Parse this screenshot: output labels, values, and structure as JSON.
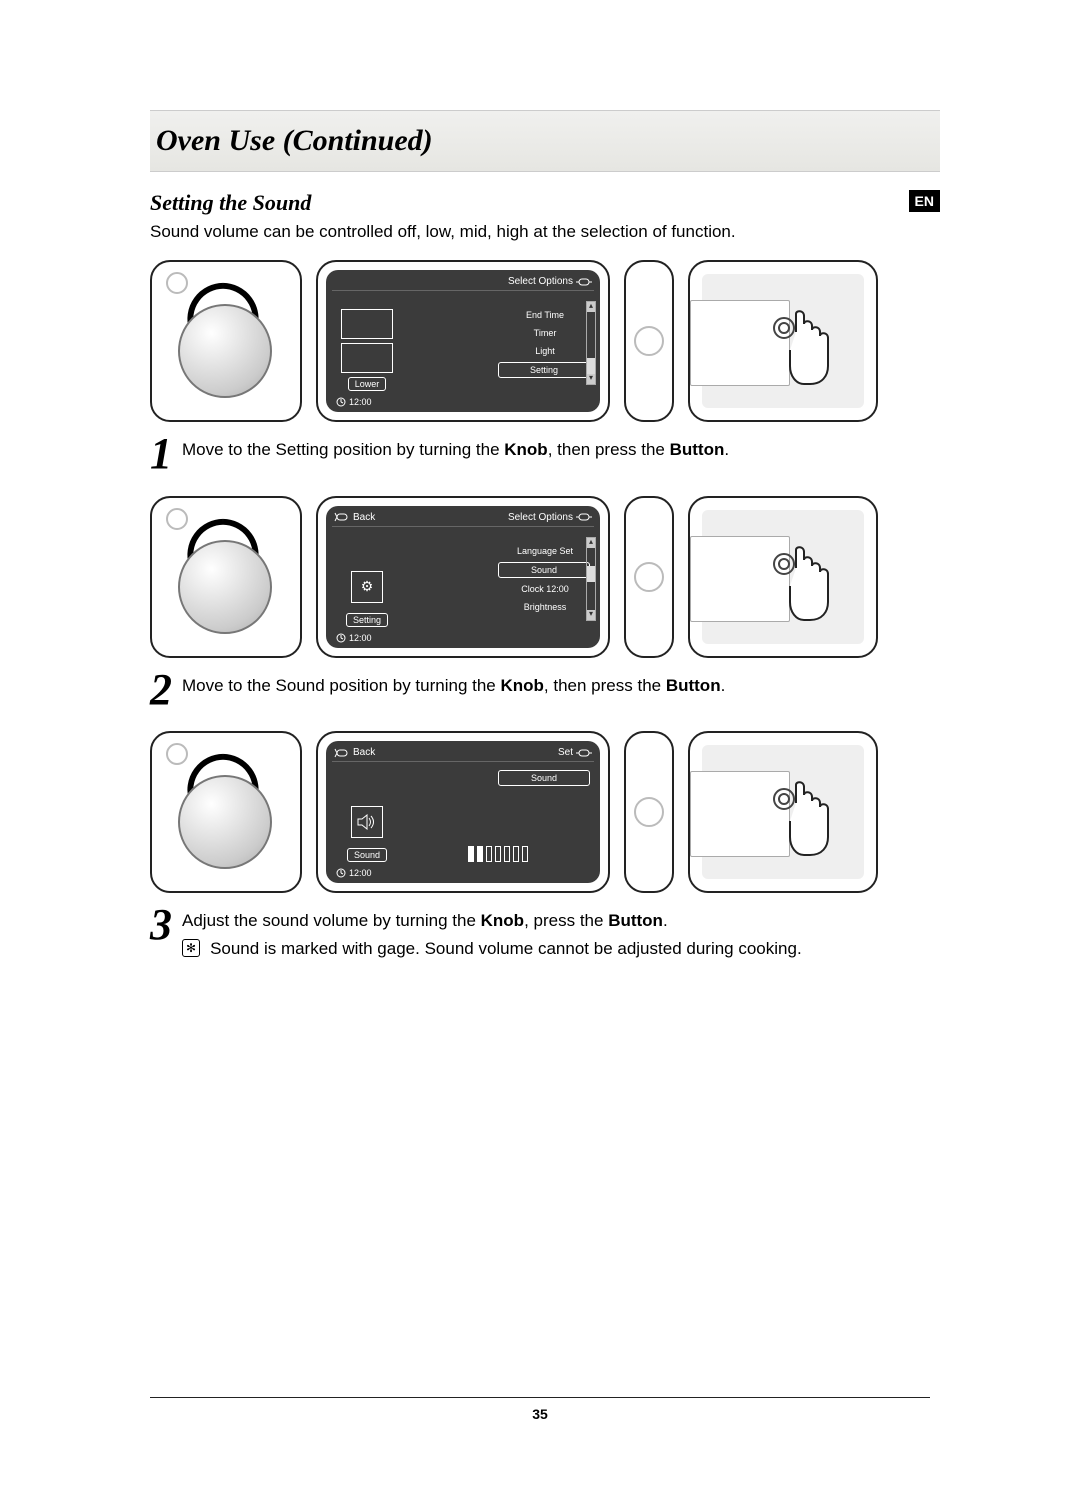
{
  "title": "Oven Use (Continued)",
  "lang_badge": "EN",
  "subhead": "Setting the Sound",
  "intro": "Sound volume can be controlled off, low, mid, high at the selection of function.",
  "page_number": "35",
  "common": {
    "clock": "12:00",
    "back_label": "Back",
    "select_options_label": "Select Options",
    "set_label": "Set"
  },
  "steps": [
    {
      "num": "1",
      "caption_pre": "Move to the Setting position by turning the ",
      "caption_bold1": "Knob",
      "caption_mid": ", then press the ",
      "caption_bold2": "Button",
      "caption_post": ".",
      "lcd": {
        "show_back": false,
        "top_right": "Select Options",
        "left_mode": "thumbs",
        "left_tag": "Lower",
        "menu": [
          "End Time",
          "Timer",
          "Light",
          "Setting"
        ],
        "highlight_index": 3,
        "scroll_pos": "bottom",
        "show_volume": false,
        "right_label": null
      }
    },
    {
      "num": "2",
      "caption_pre": "Move to the Sound position by turning the ",
      "caption_bold1": "Knob",
      "caption_mid": ", then press the ",
      "caption_bold2": "Button",
      "caption_post": ".",
      "lcd": {
        "show_back": true,
        "top_right": "Select Options",
        "left_mode": "icon",
        "left_icon": "gear",
        "left_tag": "Setting",
        "menu": [
          "Language Set",
          "Sound",
          "Clock 12:00",
          "Brightness"
        ],
        "highlight_index": 1,
        "scroll_pos": "mid",
        "show_volume": false,
        "right_label": null
      }
    },
    {
      "num": "3",
      "caption_pre": "Adjust the sound volume by turning the ",
      "caption_bold1": "Knob",
      "caption_mid": ", press the ",
      "caption_bold2": "Button",
      "caption_post": ".",
      "note": "Sound is marked with gage. Sound volume cannot be adjusted during cooking.",
      "lcd": {
        "show_back": true,
        "top_right": "Set",
        "left_mode": "icon",
        "left_icon": "speaker",
        "left_tag": "Sound",
        "menu": [],
        "right_label": "Sound",
        "show_volume": true,
        "volume_filled": 2,
        "volume_total": 7,
        "scroll_pos": null
      }
    }
  ]
}
